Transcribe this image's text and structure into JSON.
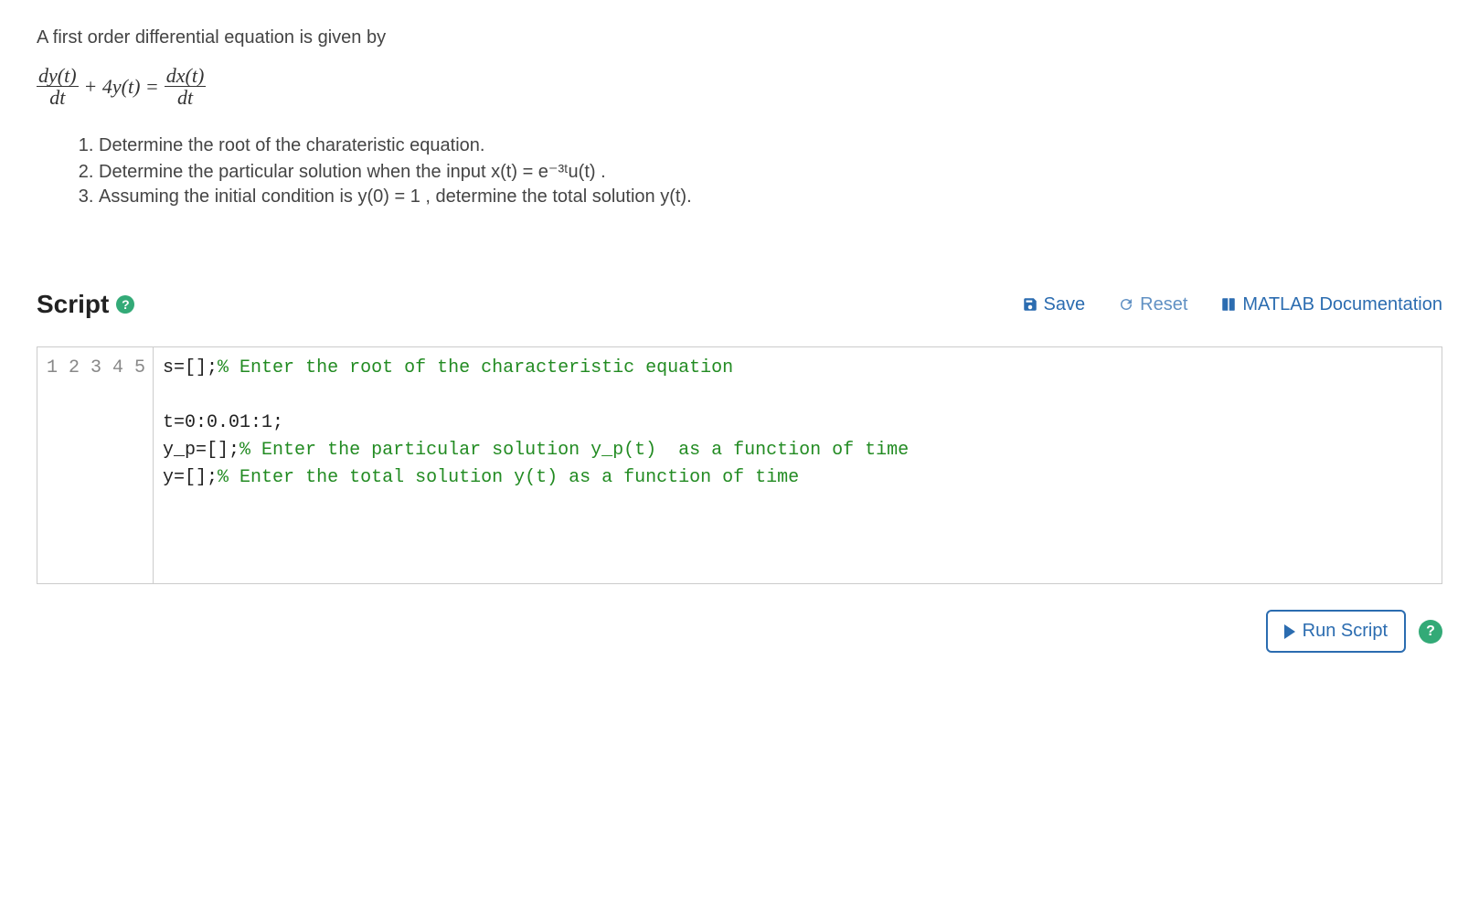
{
  "intro": "A first order differential equation is given by",
  "equation": {
    "lhs_num": "dy(t)",
    "lhs_den": "dt",
    "middle": " + 4y(t) = ",
    "rhs_num": "dx(t)",
    "rhs_den": "dt"
  },
  "tasks": [
    "Determine the root of the charateristic equation.",
    "Determine the particular solution when the input  x(t) = e⁻³ᵗu(t) .",
    "Assuming the initial condition is  y(0) = 1 , determine the total solution y(t)."
  ],
  "script": {
    "title": "Script",
    "help_glyph": "?",
    "toolbar": {
      "save": "Save",
      "reset": "Reset",
      "docs": "MATLAB Documentation"
    },
    "code_lines": [
      {
        "text": "s=[];",
        "comment": "% Enter the root of the characteristic equation"
      },
      {
        "text": "",
        "comment": ""
      },
      {
        "text": "t=0:0.01:1;",
        "comment": ""
      },
      {
        "text": "y_p=[];",
        "comment": "% Enter the particular solution y_p(t)  as a function of time"
      },
      {
        "text": "y=[];",
        "comment": "% Enter the total solution y(t) as a function of time"
      }
    ],
    "run_button": "Run Script"
  }
}
